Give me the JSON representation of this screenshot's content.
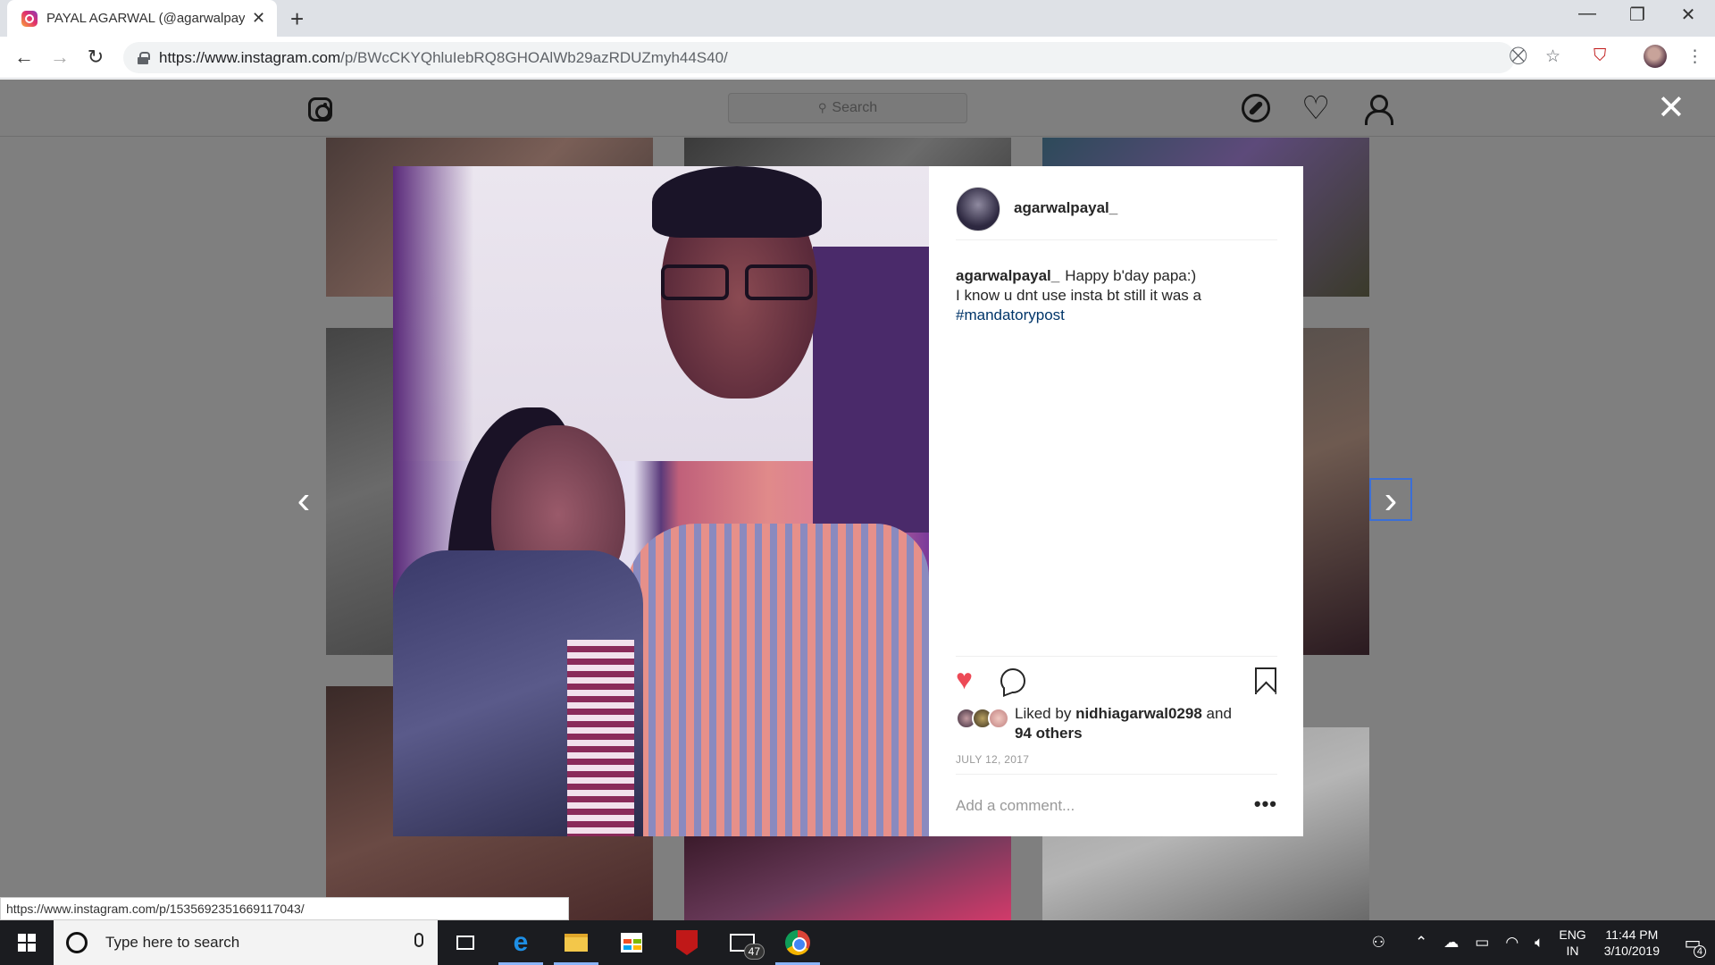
{
  "browser": {
    "tab_title": "PAYAL AGARWAL (@agarwalpaya",
    "url_host": "https://www.instagram.com",
    "url_path": "/p/BWcCKYQhluIebRQ8GHOAlWb29azRDUZmyh44S40/",
    "status_url": "https://www.instagram.com/p/1535692351669117043/"
  },
  "instagram": {
    "search_placeholder": "Search",
    "post": {
      "username": "agarwalpayal_",
      "caption_user": "agarwalpayal_",
      "caption_line1": "Happy b'day papa:)",
      "caption_line2": "I know u dnt use insta bt still it was a",
      "hashtag": "#mandatorypost",
      "liked_by_prefix": "Liked by",
      "liked_by_user": "nidhiagarwal0298",
      "liked_by_and": "and",
      "liked_by_others": "94 others",
      "date": "JULY 12, 2017",
      "comment_placeholder": "Add a comment..."
    }
  },
  "taskbar": {
    "search_placeholder": "Type here to search",
    "mail_badge": "47",
    "lang_top": "ENG",
    "lang_bottom": "IN",
    "time": "11:44 PM",
    "date": "3/10/2019",
    "notification_count": "4"
  },
  "icons": {
    "like_color": "#ed4956",
    "hashtag_color": "#003569"
  }
}
